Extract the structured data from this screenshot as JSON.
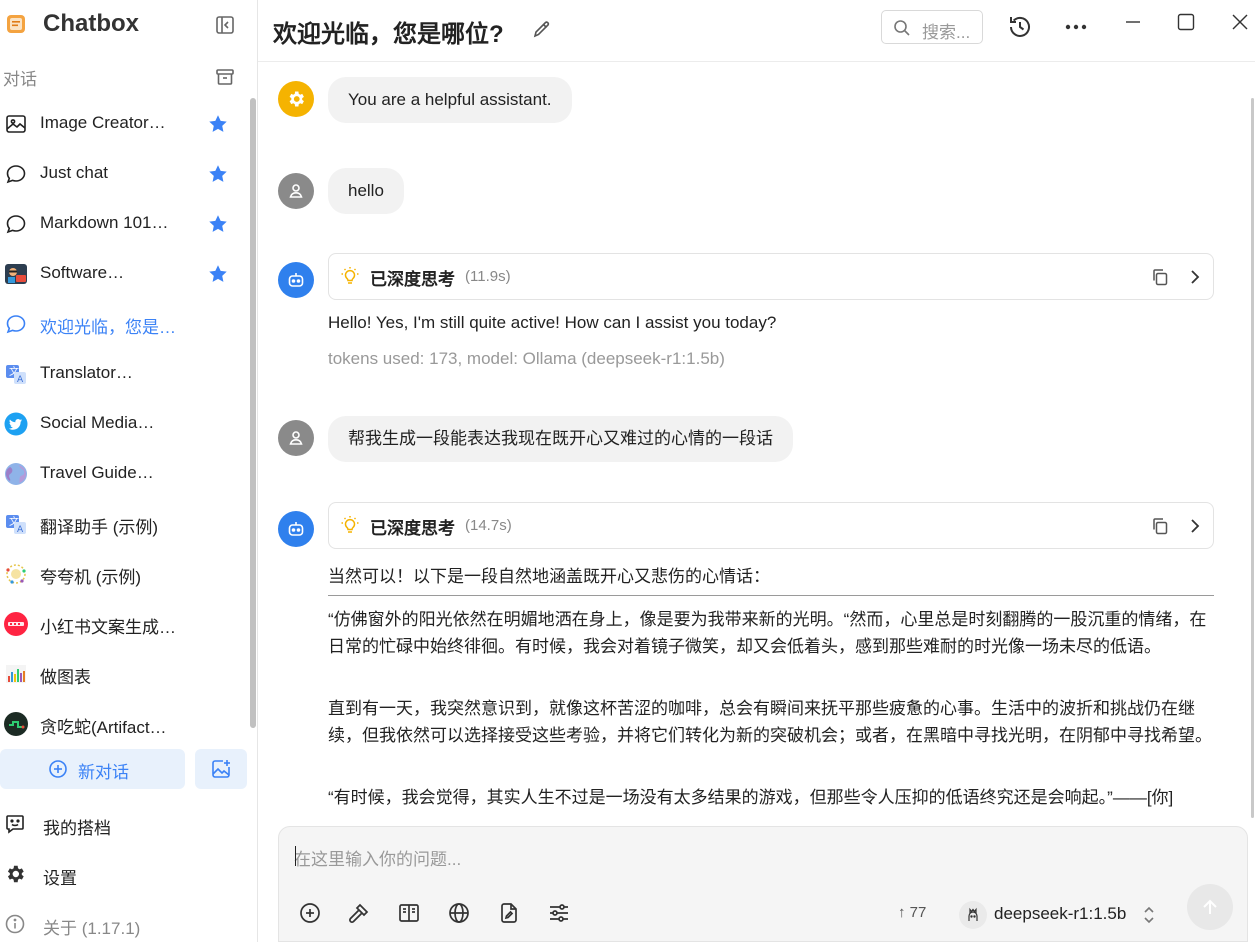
{
  "app": {
    "name": "Chatbox"
  },
  "sidebar": {
    "section_label": "对话",
    "conversations": [
      {
        "label": "Image Creator…",
        "icon": "image-icon",
        "starred": true,
        "active": false
      },
      {
        "label": "Just chat",
        "icon": "chat-bubble-icon",
        "starred": true,
        "active": false
      },
      {
        "label": "Markdown 101…",
        "icon": "chat-bubble-icon",
        "starred": true,
        "active": false
      },
      {
        "label": "Software…",
        "icon": "developer-avatar-icon",
        "starred": true,
        "active": false
      },
      {
        "label": "欢迎光临，您是…",
        "icon": "chat-bubble-icon",
        "starred": false,
        "active": true
      },
      {
        "label": "Translator…",
        "icon": "translate-icon",
        "starred": false,
        "active": false
      },
      {
        "label": "Social Media…",
        "icon": "twitter-icon",
        "starred": false,
        "active": false
      },
      {
        "label": "Travel Guide…",
        "icon": "globe-icon",
        "starred": false,
        "active": false
      },
      {
        "label": "翻译助手 (示例)",
        "icon": "translate-icon",
        "starred": false,
        "active": false
      },
      {
        "label": "夸夸机 (示例)",
        "icon": "sparkle-avatar-icon",
        "starred": false,
        "active": false
      },
      {
        "label": "小红书文案生成…",
        "icon": "xiaohongshu-icon",
        "starred": false,
        "active": false
      },
      {
        "label": "做图表",
        "icon": "chart-icon",
        "starred": false,
        "active": false
      },
      {
        "label": "贪吃蛇(Artifact…",
        "icon": "snake-game-icon",
        "starred": false,
        "active": false
      }
    ],
    "new_chat_label": "新对话",
    "footer": {
      "partners_label": "我的搭档",
      "settings_label": "设置",
      "about_label": "关于 (1.17.1)"
    }
  },
  "header": {
    "title": "欢迎光临，您是哪位?",
    "search_placeholder": "搜索..."
  },
  "messages": {
    "system": "You are a helpful assistant.",
    "user_1": "hello",
    "assistant_1": {
      "thinking_label": "已深度思考",
      "thinking_time": "(11.9s)",
      "text": "Hello! Yes, I'm still quite active! How can I assist you today?",
      "meta": "tokens used: 173, model: Ollama (deepseek-r1:1.5b)"
    },
    "user_2": "帮我生成一段能表达我现在既开心又难过的心情的一段话",
    "assistant_2": {
      "thinking_label": "已深度思考",
      "thinking_time": "(14.7s)",
      "intro": "当然可以！以下是一段自然地涵盖既开心又悲伤的心情话：",
      "paragraphs": [
        "“仿佛窗外的阳光依然在明媚地洒在身上，像是要为我带来新的光明。“然而，心里总是时刻翻腾的一股沉重的情绪，在日常的忙碌中始终徘徊。有时候，我会对着镜子微笑，却又会低着头，感到那些难耐的时光像一场未尽的低语。",
        "直到有一天，我突然意识到，就像这杯苦涩的咖啡，总会有瞬间来抚平那些疲惫的心事。生活中的波折和挑战仍在继续，但我依然可以选择接受这些考验，并将它们转化为新的突破机会；或者，在黑暗中寻找光明，在阴郁中寻找希望。",
        "“有时候，我会觉得，其实人生不过是一场没有太多结果的游戏，但那些令人压抑的低语终究还是会响起。”——[你]"
      ]
    }
  },
  "input": {
    "placeholder": "在这里输入你的问题...",
    "context_count": "↑ 77",
    "model": "deepseek-r1:1.5b"
  },
  "colors": {
    "accent": "#3b82f6",
    "star": "#3b82f6",
    "system_avatar": "#f5b301",
    "assistant_avatar": "#2f80ed",
    "user_avatar": "#8a8a8a"
  }
}
